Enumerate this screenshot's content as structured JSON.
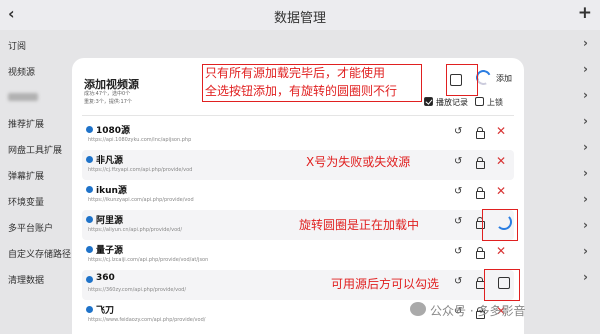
{
  "header": {
    "title": "数据管理",
    "back_icon": "chevron-left-icon",
    "add_icon": "plus-icon"
  },
  "sidebar": {
    "items": [
      {
        "label": "订阅"
      },
      {
        "label": "视频源"
      },
      {
        "label": ""
      },
      {
        "label": "推荐扩展"
      },
      {
        "label": "网盘工具扩展"
      },
      {
        "label": "弹幕扩展"
      },
      {
        "label": "环境变量"
      },
      {
        "label": "多平台账户"
      },
      {
        "label": "自定义存储路径"
      },
      {
        "label": "清理数据"
      }
    ]
  },
  "modal": {
    "title": "添加视频源",
    "sub1": "成功:47个，选中0个",
    "sub2": "重复:3个，提供:17个",
    "add_label": "添加",
    "play_record_label": "播放记录",
    "play_record_checked": true,
    "lock_label": "上锁",
    "lock_checked": false,
    "sources": [
      {
        "name": "1080源",
        "url": "https://api.1080zyku.com/inc/apijson.php",
        "status": "failed"
      },
      {
        "name": "非凡源",
        "url": "https://cj.ffzyapi.com/api.php/provide/vod",
        "status": "failed"
      },
      {
        "name": "ikun源",
        "url": "https://ikunzyapi.com/api.php/provide/vod",
        "status": "failed"
      },
      {
        "name": "阿里源",
        "url": "https://aliyun.cn/api.php/provide/vod/",
        "status": "loading"
      },
      {
        "name": "量子源",
        "url": "https://cj.lzcaiji.com/api.php/provide/vod/at/json",
        "status": "failed"
      },
      {
        "name": "360",
        "url": "https://360zy.com/api.php/provide/vod/",
        "status": "available"
      },
      {
        "name": "飞刀",
        "url": "https://www.feidaozy.com/api.php/provide/vod/",
        "status": "failed"
      }
    ]
  },
  "annotations": {
    "top_line1": "只有所有源加载完毕后，才能使用",
    "top_line2": "全选按钮添加，有旋转的圆圈则不行",
    "x_note": "X号为失败或失效源",
    "spin_note": "旋转圆圈是正在加载中",
    "check_note": "可用源后方可以勾选"
  },
  "watermark": {
    "text": "公众号 · 多多影音"
  },
  "colors": {
    "accent": "#2a7de1",
    "fail": "#d83434",
    "annotation": "#e02020"
  }
}
